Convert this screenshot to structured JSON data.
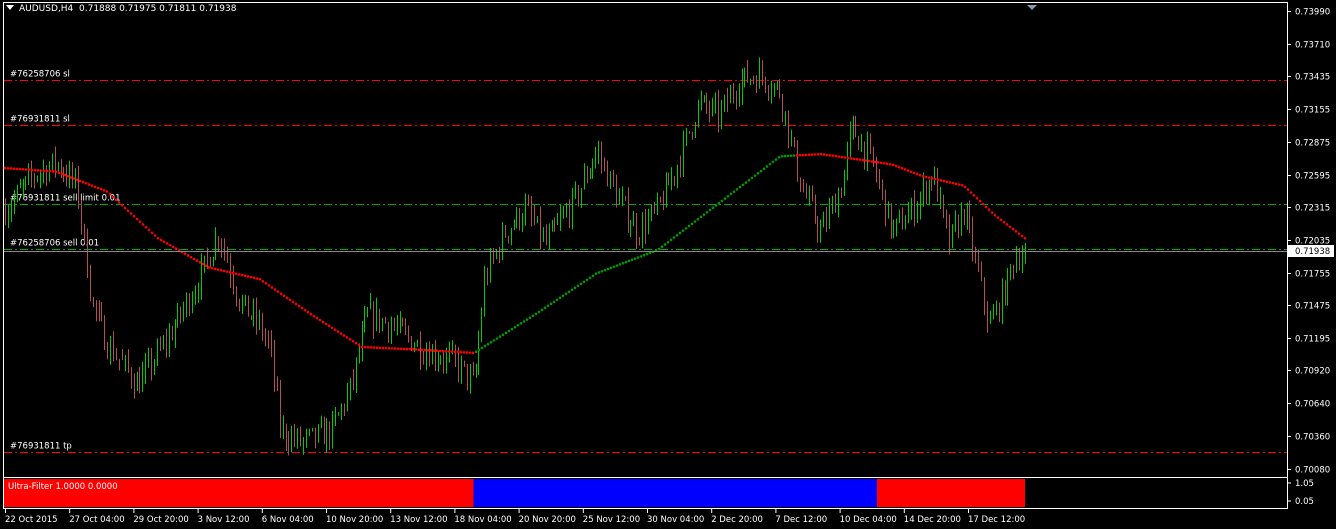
{
  "header": {
    "symbol": "AUDUSD,H4",
    "ohlc": "0.71888 0.71975 0.71811 0.71938"
  },
  "price_axis": {
    "ticks": [
      "0.73990",
      "0.73710",
      "0.73435",
      "0.73155",
      "0.72875",
      "0.72595",
      "0.72315",
      "0.72035",
      "0.71755",
      "0.71475",
      "0.71195",
      "0.70920",
      "0.70640",
      "0.70360",
      "0.70080"
    ],
    "current_price": "0.71938"
  },
  "time_axis": {
    "ticks": [
      "22 Oct 2015",
      "27 Oct 04:00",
      "29 Oct 20:00",
      "3 Nov 12:00",
      "6 Nov 04:00",
      "10 Nov 20:00",
      "13 Nov 12:00",
      "18 Nov 04:00",
      "20 Nov 20:00",
      "25 Nov 12:00",
      "30 Nov 04:00",
      "2 Dec 20:00",
      "7 Dec 12:00",
      "10 Dec 04:00",
      "14 Dec 20:00",
      "17 Dec 12:00"
    ]
  },
  "order_lines": [
    {
      "label": "#76258706 sl",
      "price": 0.734,
      "kind": "sl"
    },
    {
      "label": "#76931811 sl",
      "price": 0.7302,
      "kind": "sl"
    },
    {
      "label": "#76931811 sell limit 0.01",
      "price": 0.7234,
      "kind": "entry"
    },
    {
      "label": "#76258706 sell 0.01",
      "price": 0.71955,
      "kind": "entry"
    },
    {
      "label": "#76931811 tp",
      "price": 0.7022,
      "kind": "tp"
    }
  ],
  "indicator": {
    "label": "Ultra-Filter 1.0000 0.0000",
    "ticks": [
      "1.05",
      "0.05"
    ],
    "segments": [
      {
        "from": 0,
        "to": 0.46,
        "state": "down"
      },
      {
        "from": 0.46,
        "to": 0.855,
        "state": "up"
      },
      {
        "from": 0.855,
        "to": 1,
        "state": "down"
      }
    ]
  },
  "colors": {
    "background": "#000000",
    "bull": "#00cc00",
    "bear": "#b05050",
    "ma_up": "#009900",
    "ma_down": "#ff0000",
    "stop_line": "#ff0000",
    "entry_line": "#00aa00",
    "indicator_up": "#0000ff",
    "indicator_down": "#ff0000"
  },
  "chart_data": {
    "type": "candlestick",
    "ylim": [
      0.7006,
      0.7401
    ],
    "knots": [
      [
        0,
        0.723
      ],
      [
        0.03,
        0.726
      ],
      [
        0.05,
        0.727
      ],
      [
        0.07,
        0.725
      ],
      [
        0.085,
        0.715
      ],
      [
        0.1,
        0.7115
      ],
      [
        0.13,
        0.708
      ],
      [
        0.16,
        0.712
      ],
      [
        0.19,
        0.717
      ],
      [
        0.21,
        0.721
      ],
      [
        0.23,
        0.715
      ],
      [
        0.25,
        0.713
      ],
      [
        0.26,
        0.711
      ],
      [
        0.27,
        0.704
      ],
      [
        0.29,
        0.703
      ],
      [
        0.32,
        0.704
      ],
      [
        0.34,
        0.708
      ],
      [
        0.355,
        0.714
      ],
      [
        0.38,
        0.713
      ],
      [
        0.41,
        0.711
      ],
      [
        0.44,
        0.71
      ],
      [
        0.46,
        0.708
      ],
      [
        0.47,
        0.717
      ],
      [
        0.49,
        0.721
      ],
      [
        0.51,
        0.723
      ],
      [
        0.53,
        0.72
      ],
      [
        0.56,
        0.724
      ],
      [
        0.58,
        0.728
      ],
      [
        0.6,
        0.724
      ],
      [
        0.62,
        0.721
      ],
      [
        0.64,
        0.723
      ],
      [
        0.66,
        0.727
      ],
      [
        0.68,
        0.732
      ],
      [
        0.7,
        0.731
      ],
      [
        0.72,
        0.734
      ],
      [
        0.74,
        0.7345
      ],
      [
        0.76,
        0.733
      ],
      [
        0.78,
        0.725
      ],
      [
        0.8,
        0.721
      ],
      [
        0.82,
        0.725
      ],
      [
        0.83,
        0.73
      ],
      [
        0.85,
        0.727
      ],
      [
        0.87,
        0.721
      ],
      [
        0.89,
        0.723
      ],
      [
        0.91,
        0.726
      ],
      [
        0.925,
        0.72
      ],
      [
        0.94,
        0.723
      ],
      [
        0.955,
        0.717
      ],
      [
        0.965,
        0.713
      ],
      [
        0.98,
        0.716
      ],
      [
        0.99,
        0.719
      ],
      [
        1.0,
        0.71938
      ]
    ],
    "ma_knots": [
      [
        0,
        0.7265
      ],
      [
        0.05,
        0.7262
      ],
      [
        0.1,
        0.7245
      ],
      [
        0.15,
        0.7205
      ],
      [
        0.2,
        0.718
      ],
      [
        0.25,
        0.717
      ],
      [
        0.3,
        0.714
      ],
      [
        0.35,
        0.7112
      ],
      [
        0.4,
        0.711
      ],
      [
        0.46,
        0.7107
      ],
      [
        0.52,
        0.714
      ],
      [
        0.58,
        0.7175
      ],
      [
        0.64,
        0.7195
      ],
      [
        0.7,
        0.7235
      ],
      [
        0.76,
        0.7275
      ],
      [
        0.8,
        0.7277
      ],
      [
        0.84,
        0.7272
      ],
      [
        0.87,
        0.7268
      ],
      [
        0.9,
        0.7258
      ],
      [
        0.94,
        0.725
      ],
      [
        0.97,
        0.7225
      ],
      [
        1.0,
        0.7205
      ]
    ],
    "ma_turn": [
      0.46,
      0.775
    ]
  }
}
